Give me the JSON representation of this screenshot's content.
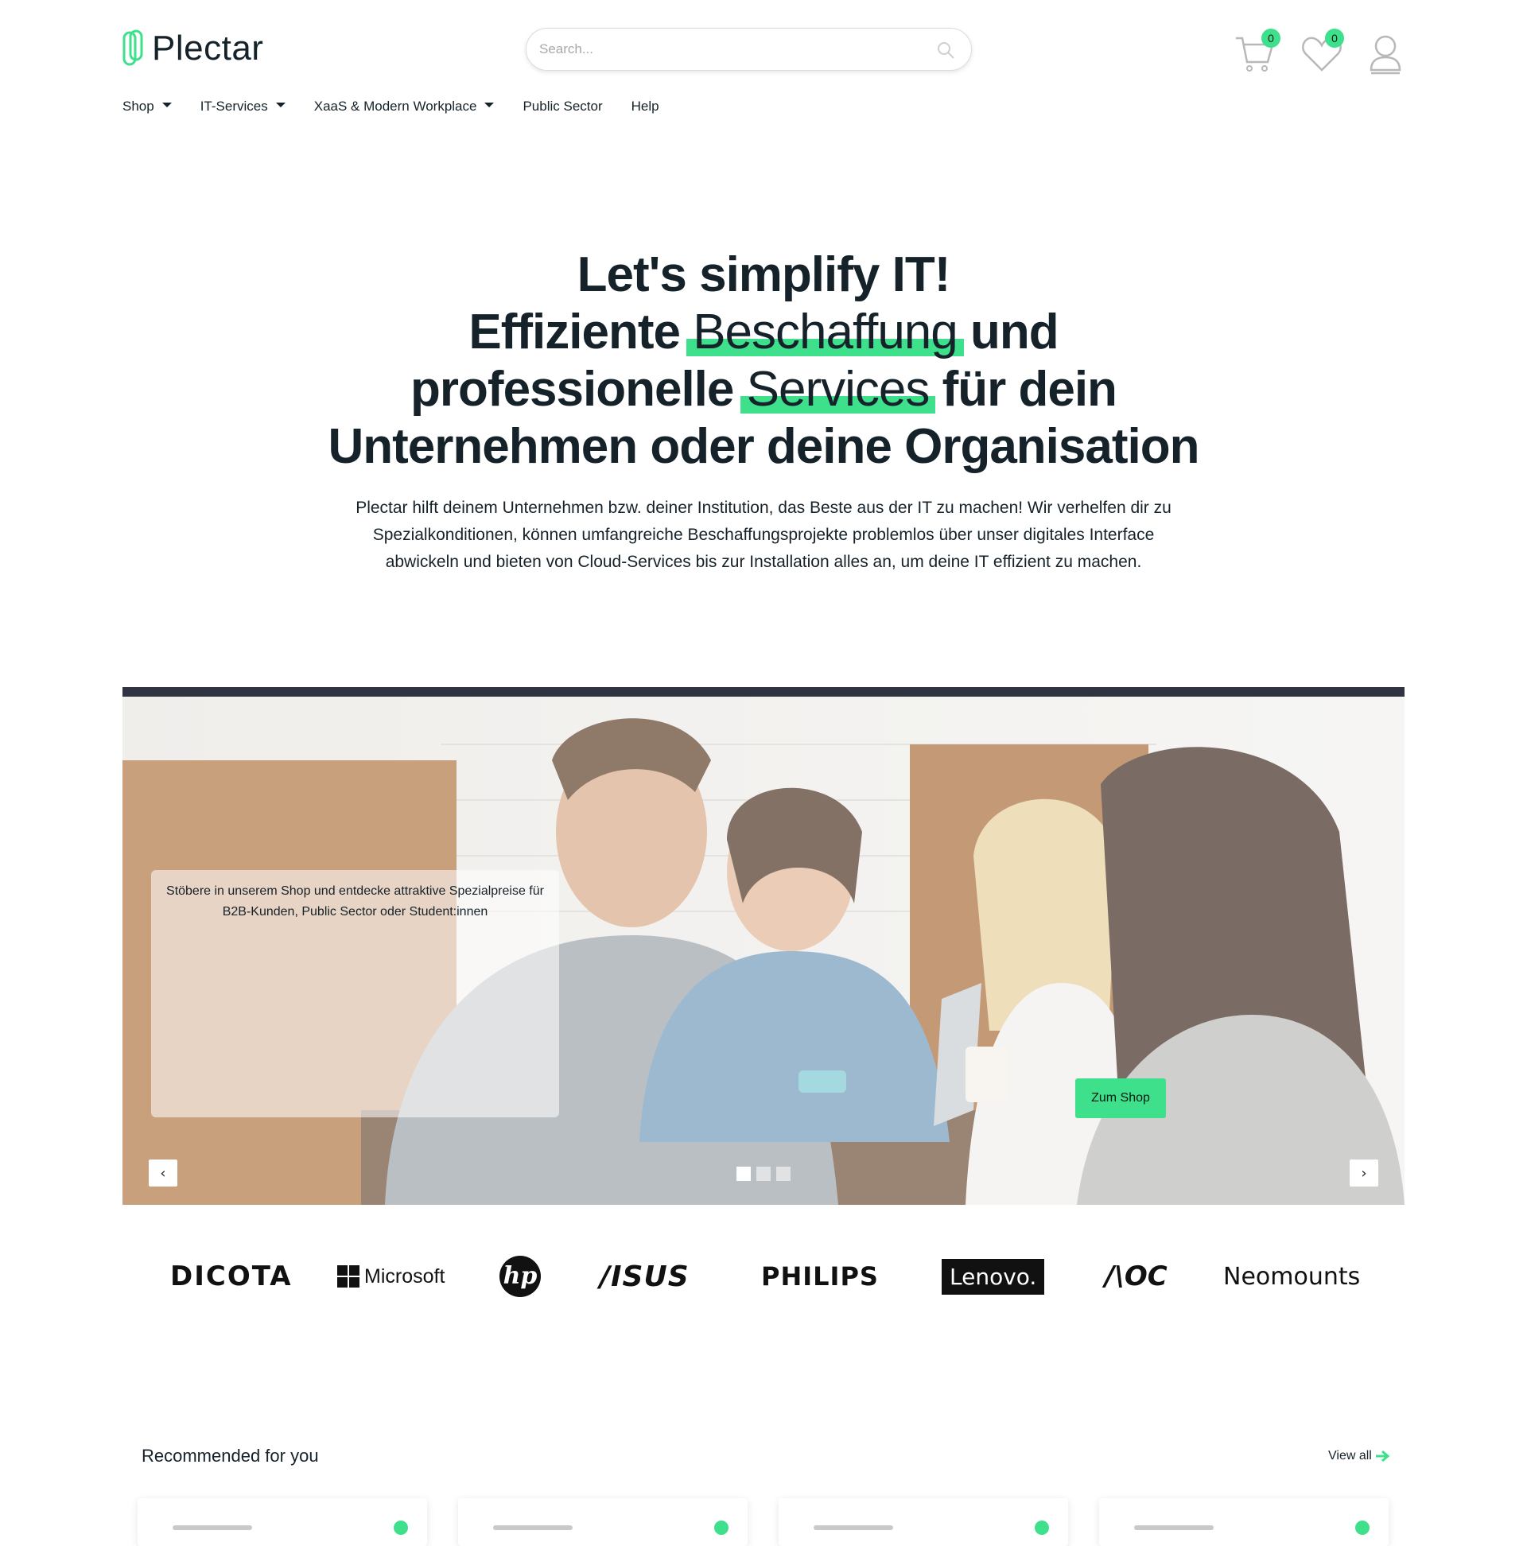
{
  "header": {
    "brand": "Plectar",
    "search_placeholder": "Search...",
    "cart_count": "0",
    "wishlist_count": "0"
  },
  "nav": {
    "items": [
      {
        "label": "Shop",
        "dropdown": true
      },
      {
        "label": "IT-Services",
        "dropdown": true
      },
      {
        "label": "XaaS & Modern Workplace",
        "dropdown": true
      },
      {
        "label": "Public Sector",
        "dropdown": false
      },
      {
        "label": "Help",
        "dropdown": false
      }
    ]
  },
  "hero": {
    "line1": "Let's simplify IT!",
    "line2_pre": "Effiziente ",
    "line2_hl": "Beschaffung",
    "line2_post": " und",
    "line3_pre": "professionelle ",
    "line3_hl": "Services",
    "line3_post": " für dein",
    "line4": "Unternehmen oder deine Organisation",
    "subtitle": "Plectar hilft deinem Unternehmen bzw. deiner Institution, das Beste aus der IT zu machen! Wir verhelfen dir zu Spezialkonditionen, können umfangreiche Beschaffungsprojekte problemlos über unser digitales Interface abwickeln und bieten von Cloud-Services bis zur Installation alles an, um deine IT effizient zu machen."
  },
  "carousel": {
    "caption": "Stöbere in unserem Shop und entdecke attraktive Spezialpreise für B2B-Kunden, Public Sector oder Student:innen",
    "button_label": "Zum Shop",
    "prev_glyph": "‹",
    "next_glyph": "›",
    "slide_count": 3,
    "active_slide": 1
  },
  "brands": {
    "dicota": "DICOTA",
    "microsoft": "Microsoft",
    "hp": "hp",
    "asus": "/ISUS",
    "philips": "PHILIPS",
    "lenovo": "Lenovo.",
    "aoc": "/\\OC",
    "neomounts": "Neomounts"
  },
  "recommended": {
    "title": "Recommended for you",
    "view_all": "View all"
  },
  "colors": {
    "accent": "#3ee08c",
    "text": "#16222a"
  }
}
